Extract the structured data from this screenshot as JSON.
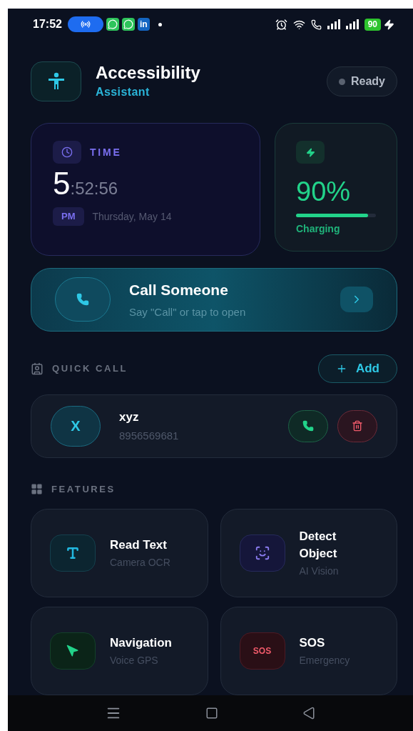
{
  "status_bar": {
    "time": "17:52",
    "app_badge": "in",
    "battery": "90"
  },
  "header": {
    "title": "Accessibility",
    "subtitle": "Assistant",
    "status": "Ready"
  },
  "time_card": {
    "label": "TIME",
    "hour": "5",
    "rest": ":52:56",
    "meridiem": "PM",
    "date": "Thursday, May 14"
  },
  "battery_card": {
    "percent": "90%",
    "level": 0.9,
    "status": "Charging"
  },
  "call_card": {
    "title": "Call Someone",
    "subtitle": "Say \"Call\" or tap to open"
  },
  "quick_call": {
    "heading": "QUICK CALL",
    "add_button": "Add",
    "contacts": [
      {
        "initial": "X",
        "name": "xyz",
        "number": "8956569681"
      }
    ]
  },
  "features": {
    "heading": "FEATURES",
    "items": [
      {
        "kind": "text",
        "title": "Read Text",
        "subtitle": "Camera OCR",
        "color": "#22b8e0"
      },
      {
        "kind": "object",
        "title": "Detect Object",
        "subtitle": "AI Vision",
        "color": "#8b7cf0"
      },
      {
        "kind": "navigation",
        "title": "Navigation",
        "subtitle": "Voice GPS",
        "color": "#22d38a"
      },
      {
        "kind": "sos",
        "title": "SOS",
        "subtitle": "Emergency",
        "color": "#f05a6a",
        "icon_text": "SOS"
      }
    ]
  }
}
